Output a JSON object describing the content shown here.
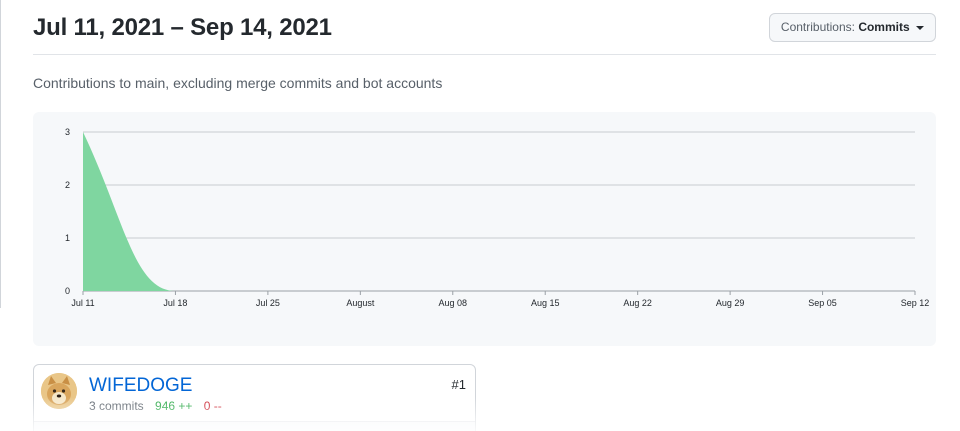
{
  "header": {
    "range_title": "Jul 11, 2021 – Sep 14, 2021",
    "contrib_prefix": "Contributions:",
    "contrib_value": "Commits"
  },
  "subtitle": "Contributions to main, excluding merge commits and bot accounts",
  "chart_data": {
    "type": "area",
    "x_ticks": [
      "Jul 11",
      "Jul 18",
      "Jul 25",
      "August",
      "Aug 08",
      "Aug 15",
      "Aug 22",
      "Aug 29",
      "Sep 05",
      "Sep 12"
    ],
    "y_ticks": [
      0,
      1,
      2,
      3
    ],
    "ylim": [
      0,
      3
    ],
    "grid": true,
    "fill_color": "#7fd6a0",
    "x": [
      "Jul 11",
      "Jul 18",
      "Jul 25",
      "August",
      "Aug 08",
      "Aug 15",
      "Aug 22",
      "Aug 29",
      "Sep 05",
      "Sep 12"
    ],
    "values": [
      3,
      0,
      0,
      0,
      0,
      0,
      0,
      0,
      0,
      0
    ]
  },
  "contributor": {
    "username": "WIFEDOGE",
    "rank": "#1",
    "commits": "3 commits",
    "additions": "946 ++",
    "deletions": "0 --"
  }
}
